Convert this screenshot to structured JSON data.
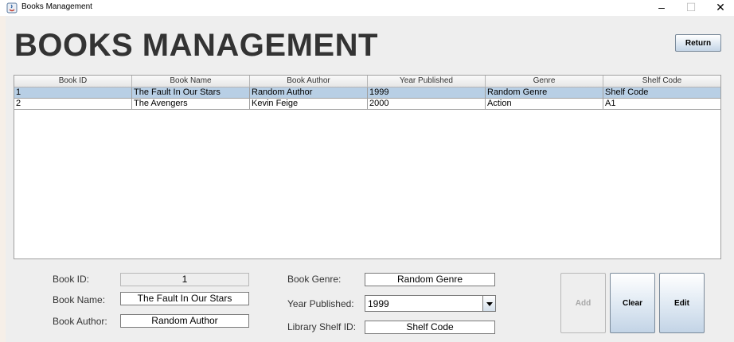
{
  "window": {
    "title": "Books Management",
    "controls": {
      "minimize": "–",
      "maximize": "☐",
      "close": "✕"
    }
  },
  "header": {
    "title": "BOOKS MANAGEMENT",
    "return_label": "Return"
  },
  "table": {
    "columns": [
      "Book ID",
      "Book Name",
      "Book Author",
      "Year Published",
      "Genre",
      "Shelf Code"
    ],
    "rows": [
      [
        "1",
        "The Fault In Our Stars",
        "Random Author",
        "1999",
        "Random Genre",
        "Shelf Code"
      ],
      [
        "2",
        "The Avengers",
        "Kevin Feige",
        "2000",
        "Action",
        "A1"
      ]
    ],
    "selected_row": 0
  },
  "form": {
    "book_id_label": "Book ID:",
    "book_id_value": "1",
    "book_name_label": "Book Name:",
    "book_name_value": "The Fault In Our Stars",
    "book_author_label": "Book Author:",
    "book_author_value": "Random Author",
    "book_genre_label": "Book Genre:",
    "book_genre_value": "Random Genre",
    "year_published_label": "Year Published:",
    "year_published_value": "1999",
    "shelf_id_label": "Library Shelf ID:",
    "shelf_id_value": "Shelf Code"
  },
  "actions": {
    "add_label": "Add",
    "clear_label": "Clear",
    "edit_label": "Edit"
  },
  "colors": {
    "selection": "#b8cfe5",
    "heading": "#333333",
    "background": "#eeeeee"
  }
}
